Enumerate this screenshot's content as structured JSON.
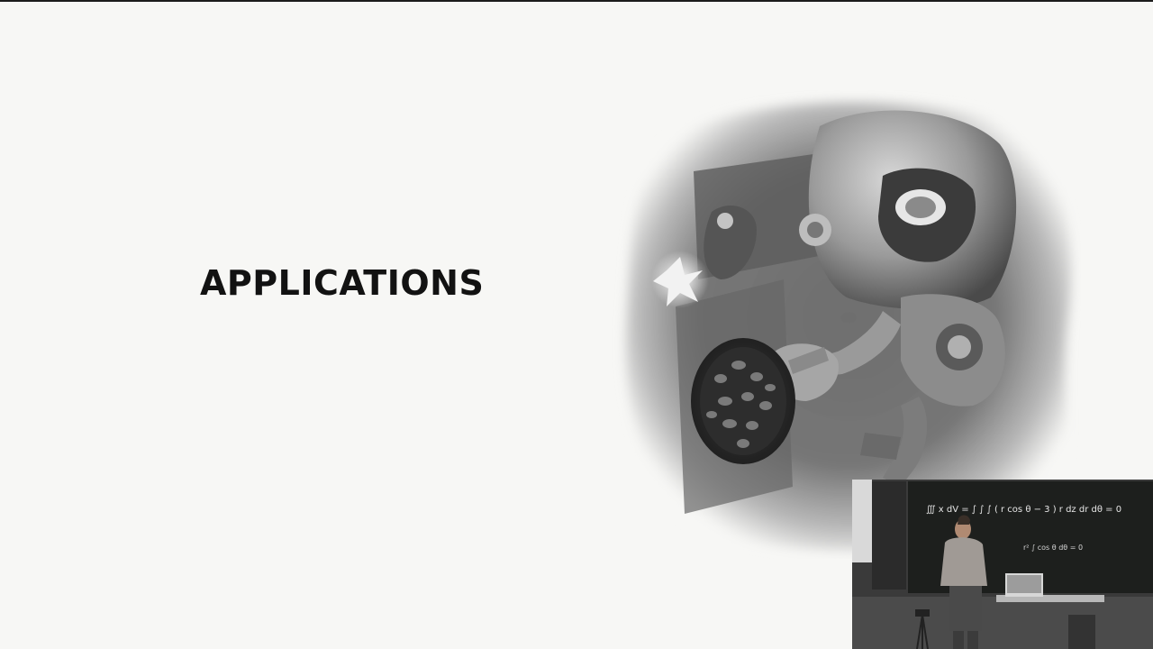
{
  "slide": {
    "title": "APPLICATIONS"
  },
  "illustration": {
    "subject": "robot-cooking-illustration"
  },
  "webcam": {
    "subject": "lecturer-at-blackboard-video",
    "board_text_line1": "∭ x dV = ∫ ∫ ∫ ( r cos θ − 3 ) r dz dr dθ = 0",
    "board_text_line2": "r² ∫ cos θ dθ = 0"
  },
  "colors": {
    "background": "#f7f7f5",
    "title": "#121212",
    "board": "#1d1f1d"
  }
}
